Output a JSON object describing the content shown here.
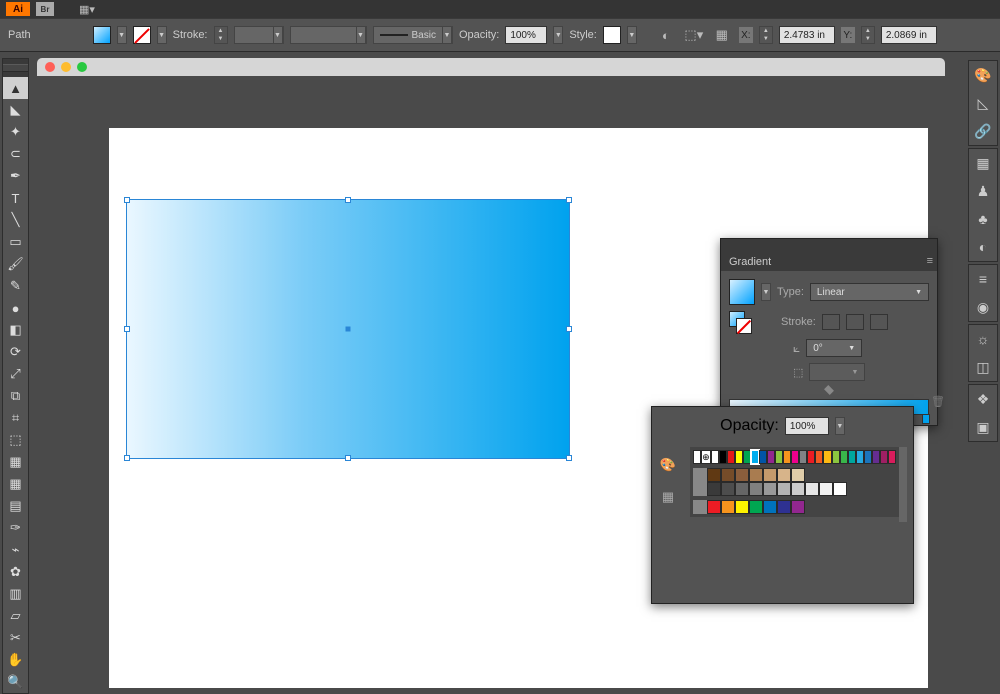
{
  "app": {
    "logo": "Ai",
    "bridge": "Br"
  },
  "controlbar": {
    "selection_label": "Path",
    "stroke_label": "Stroke:",
    "brush_label": "Basic",
    "opacity_label": "Opacity:",
    "opacity_value": "100%",
    "style_label": "Style:",
    "x_label": "X:",
    "x_value": "2.4783 in",
    "y_label": "Y:",
    "y_value": "2.0869 in"
  },
  "tools": [
    "selection",
    "direct-selection",
    "magic-wand",
    "lasso",
    "pen",
    "type",
    "line",
    "rectangle",
    "paintbrush",
    "pencil",
    "blob-brush",
    "eraser",
    "rotate",
    "scale",
    "width",
    "free-transform",
    "shape-builder",
    "perspective",
    "mesh",
    "gradient",
    "eyedropper",
    "blend",
    "symbol-sprayer",
    "column-graph",
    "artboard",
    "slice",
    "hand",
    "zoom"
  ],
  "tool_glyphs": [
    "▲",
    "◣",
    "✦",
    "⊂",
    "✒",
    "T",
    "╲",
    "▭",
    "🖌",
    "✎",
    "●",
    "◧",
    "⟳",
    "⤢",
    "⧉",
    "⌗",
    "⬚",
    "▦",
    "▦",
    "▤",
    "✑",
    "⌁",
    "✿",
    "▥",
    "▱",
    "✂",
    "✋",
    "🔍"
  ],
  "right_panels": [
    [
      "palette",
      "curve",
      "links"
    ],
    [
      "crop",
      "human",
      "clover",
      "transparency"
    ],
    [
      "list",
      "appearance"
    ],
    [
      "sun",
      "pathfinder"
    ],
    [
      "layers",
      "artboards"
    ]
  ],
  "right_glyphs": {
    "palette": "🎨",
    "curve": "◺",
    "links": "🔗",
    "crop": "▦",
    "human": "♟",
    "clover": "♣",
    "transparency": "◐",
    "list": "≡",
    "appearance": "◉",
    "sun": "☼",
    "pathfinder": "◫",
    "layers": "❖",
    "artboards": "▣"
  },
  "gradient_panel": {
    "title": "Gradient",
    "type_label": "Type:",
    "type_value": "Linear",
    "stroke_label": "Stroke:",
    "angle_value": "0°"
  },
  "swatch_popup": {
    "opacity_label": "Opacity:",
    "opacity_value": "100%",
    "rows": [
      [
        "#ffffff",
        "#000000",
        "#e61919",
        "#ffff00",
        "#00a551",
        "#00adef",
        "#0054a6",
        "#92278f",
        "#8cc63f",
        "#f7941d",
        "#ed008c",
        "#808285",
        "#ec1c24",
        "#f15a22",
        "#fdb913",
        "#8bc53f",
        "#39b54a",
        "#00a79d",
        "#27aae1",
        "#1b75bc",
        "#652d90",
        "#9e1f63",
        "#d91c5c"
      ],
      [
        "#603913",
        "#754c29",
        "#8b5e3c",
        "#a97c50",
        "#c49a6c",
        "#d7b48a",
        "#e0cda9"
      ],
      [
        "#3a3a3a",
        "#4d4d4d",
        "#666666",
        "#808080",
        "#999999",
        "#b3b3b3",
        "#cccccc",
        "#e6e6e6",
        "#f2f2f2",
        "#ffffff"
      ],
      [
        "#ed1c24",
        "#f7941d",
        "#fff200",
        "#00a651",
        "#0072bc",
        "#2e3192",
        "#92278f"
      ]
    ]
  }
}
